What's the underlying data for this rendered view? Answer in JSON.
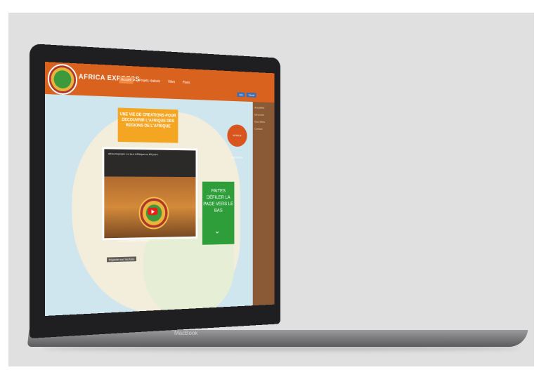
{
  "site": {
    "brand": "AFRICA EXPRESS",
    "nav": [
      "Accueil",
      "Projets réalisés",
      "Villes",
      "Plans"
    ],
    "social": [
      "Like",
      "Tweet"
    ],
    "banner_text": "UNE VIE DE CREATIONS POUR DECOUVRIR L'AFRIQUE DES REGIONS DE L'AFRIQUE",
    "sun_text": "AFRICA EXPRESS",
    "scroll_cta": "FAITES DÉFILER LA PAGE VERS LE BAS",
    "sidebar_items": [
      "Actualités",
      "Découvrir",
      "Nos offres",
      "Contact"
    ]
  },
  "video": {
    "title": "Africa Express: Le tour d'Afrique en 80 jours",
    "caption": "Un tour d'Afrique en 80 jours",
    "watch_on": "Regarder sur YouTube"
  },
  "device": {
    "label": "MacBook"
  }
}
